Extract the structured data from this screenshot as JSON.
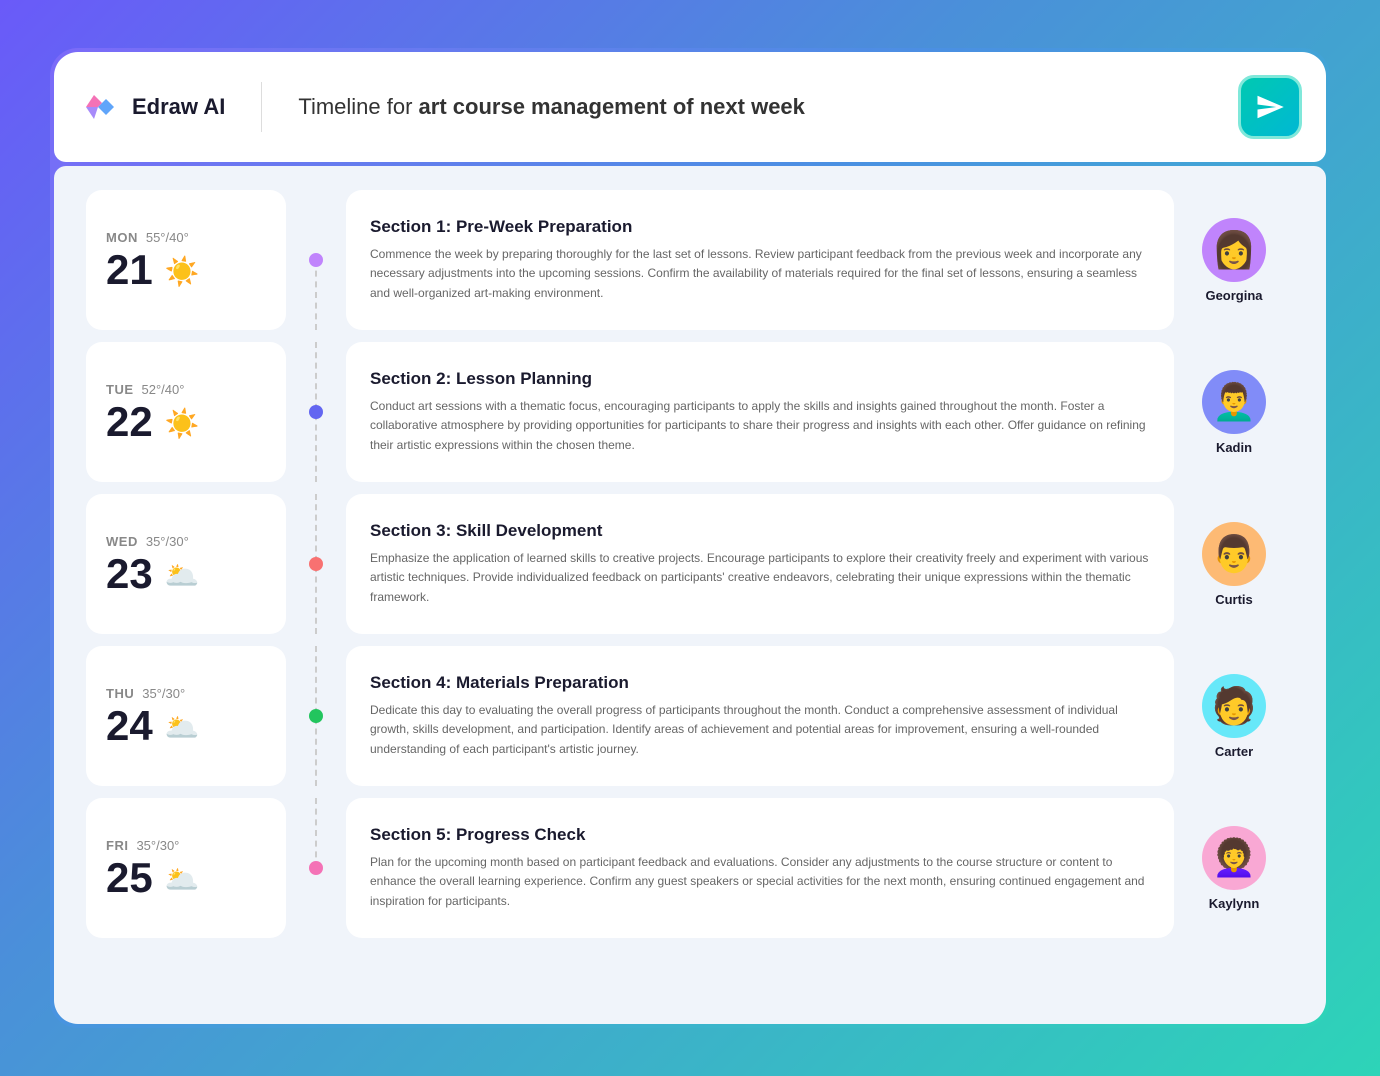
{
  "header": {
    "logo_text": "Edraw AI",
    "title_prefix": "Timeline for ",
    "title_bold": "art course management of next week",
    "send_label": "Send"
  },
  "rows": [
    {
      "day": "MON",
      "date": "21",
      "temp": "55°/40°",
      "weather": "☀️",
      "dot_class": "dot-purple",
      "section_title": "Section 1: Pre-Week Preparation",
      "section_text": "Commence the week by preparing thoroughly for the last set of lessons. Review participant feedback from the previous week and incorporate any necessary adjustments into the upcoming sessions. Confirm the availability of materials required for the final set of lessons, ensuring a seamless and well-organized art-making environment.",
      "person_name": "Georgina",
      "avatar_class": "avatar-georgina",
      "avatar_emoji": "👩",
      "connector_class": "connector-first"
    },
    {
      "day": "TUE",
      "date": "22",
      "temp": "52°/40°",
      "weather": "☀️",
      "dot_class": "dot-blue",
      "section_title": "Section 2: Lesson Planning",
      "section_text": "Conduct art sessions with a thematic focus, encouraging participants to apply the skills and insights gained throughout the month. Foster a collaborative atmosphere by providing opportunities for participants to share their progress and insights with each other. Offer guidance on refining their artistic expressions within the chosen theme.",
      "person_name": "Kadin",
      "avatar_class": "avatar-kadin",
      "avatar_emoji": "👨‍🦱",
      "connector_class": ""
    },
    {
      "day": "WED",
      "date": "23",
      "temp": "35°/30°",
      "weather": "🌥️",
      "dot_class": "dot-red",
      "section_title": "Section 3: Skill Development",
      "section_text": "Emphasize the application of learned skills to creative projects. Encourage participants to explore their creativity freely and experiment with various artistic techniques. Provide individualized feedback on participants' creative endeavors, celebrating their unique expressions within the thematic framework.",
      "person_name": "Curtis",
      "avatar_class": "avatar-curtis",
      "avatar_emoji": "👨",
      "connector_class": ""
    },
    {
      "day": "THU",
      "date": "24",
      "temp": "35°/30°",
      "weather": "🌥️",
      "dot_class": "dot-green",
      "section_title": "Section 4: Materials Preparation",
      "section_text": "Dedicate this day to evaluating the overall progress of participants throughout the month. Conduct a comprehensive assessment of individual growth, skills development, and participation. Identify areas of achievement and potential areas for improvement, ensuring a well-rounded understanding of each participant's artistic journey.",
      "person_name": "Carter",
      "avatar_class": "avatar-carter",
      "avatar_emoji": "🧑",
      "connector_class": ""
    },
    {
      "day": "FRI",
      "date": "25",
      "temp": "35°/30°",
      "weather": "🌥️",
      "dot_class": "dot-pink",
      "section_title": "Section 5: Progress Check",
      "section_text": "Plan for the upcoming month based on participant feedback and evaluations. Consider any adjustments to the course structure or content to enhance the overall learning experience. Confirm any guest speakers or special activities for the next month, ensuring continued engagement and inspiration for participants.",
      "person_name": "Kaylynn",
      "avatar_class": "avatar-kaylynn",
      "avatar_emoji": "👩‍🦱",
      "connector_class": "connector-last"
    }
  ]
}
